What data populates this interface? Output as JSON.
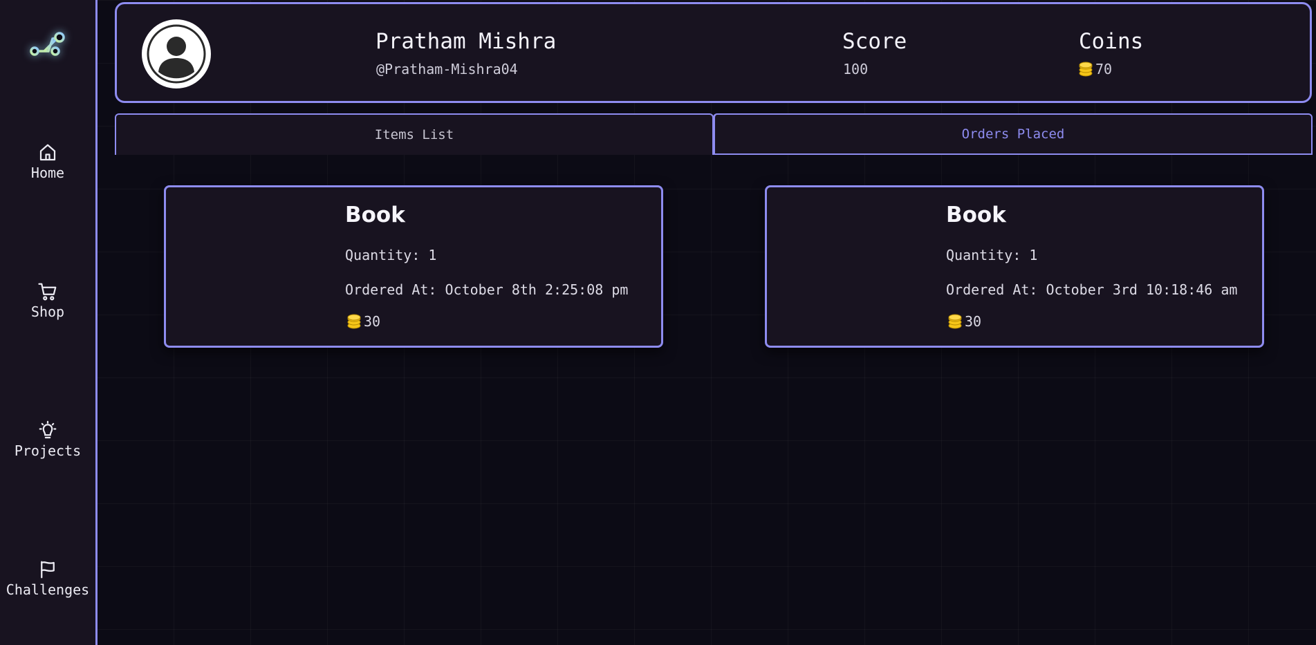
{
  "sidebar": {
    "logo_icon": "nodes-logo-icon",
    "items": [
      {
        "label": "Home",
        "icon": "home-icon"
      },
      {
        "label": "Shop",
        "icon": "cart-icon"
      },
      {
        "label": "Projects",
        "icon": "lightbulb-icon"
      },
      {
        "label": "Challenges",
        "icon": "flag-icon"
      }
    ]
  },
  "profile": {
    "name": "Pratham Mishra",
    "handle": "@Pratham-Mishra04",
    "score_label": "Score",
    "score_value": "100",
    "coins_label": "Coins",
    "coins_value": "70"
  },
  "tabs": [
    {
      "label": "Items List",
      "active": false
    },
    {
      "label": "Orders Placed",
      "active": true
    }
  ],
  "orders": [
    {
      "title": "Book",
      "quantity": "Quantity: 1",
      "ordered_at": "Ordered At: October 8th 2:25:08 pm",
      "price": "30"
    },
    {
      "title": "Book",
      "quantity": "Quantity: 1",
      "ordered_at": "Ordered At: October 3rd 10:18:46 am",
      "price": "30"
    }
  ],
  "colors": {
    "accent": "#8e8cf0",
    "background": "#0c0b15",
    "panel": "#181320",
    "coin": "#f5c518"
  }
}
